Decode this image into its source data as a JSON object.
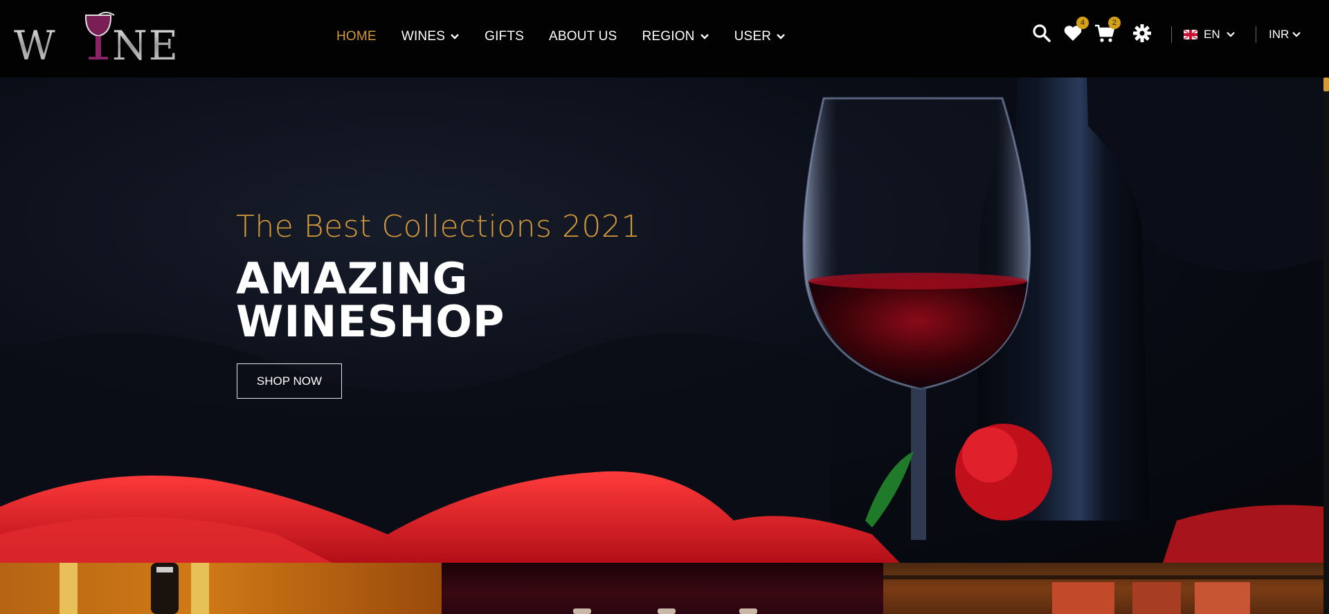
{
  "brand": {
    "logo_text": "WINE"
  },
  "nav": {
    "items": [
      {
        "label": "HOME",
        "active": true,
        "dropdown": false
      },
      {
        "label": "WINES",
        "active": false,
        "dropdown": true
      },
      {
        "label": "GIFTS",
        "active": false,
        "dropdown": false
      },
      {
        "label": "ABOUT US",
        "active": false,
        "dropdown": false
      },
      {
        "label": "REGION",
        "active": false,
        "dropdown": true
      },
      {
        "label": "USER",
        "active": false,
        "dropdown": true
      }
    ]
  },
  "tools": {
    "search_icon": "search-icon",
    "wishlist_count": "4",
    "cart_count": "2",
    "settings_icon": "gear-icon",
    "language": "EN",
    "currency": "INR"
  },
  "hero": {
    "subtitle": "The Best Collections 2021",
    "title_line1": "AMAZING",
    "title_line2": "WINESHOP",
    "cta_label": "SHOP NOW"
  },
  "colors": {
    "accent": "#d39a3a",
    "badge": "#d4a017",
    "header_bg": "#020203"
  }
}
